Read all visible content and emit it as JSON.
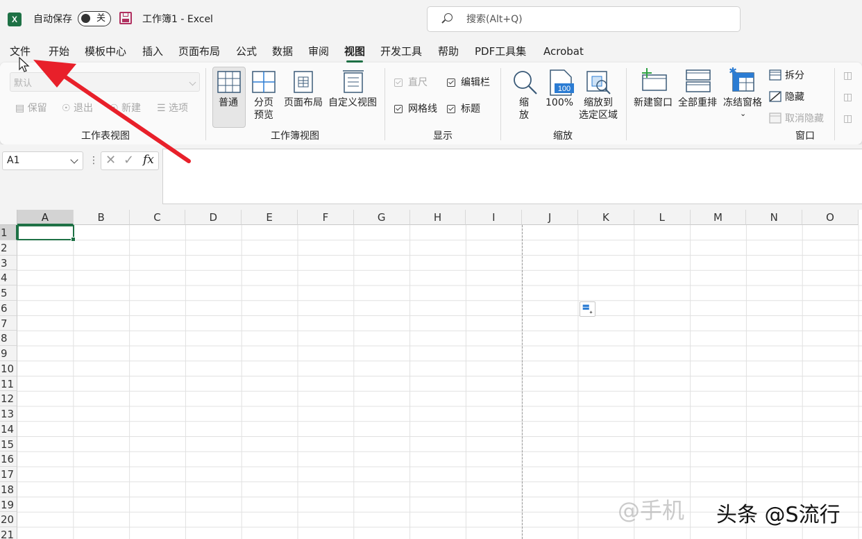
{
  "titlebar": {
    "app_logo": "X",
    "autosave_label": "自动保存",
    "autosave_state": "关",
    "doc_title": "工作簿1  -  Excel",
    "search_placeholder": "搜索(Alt+Q)"
  },
  "menu": {
    "tabs": [
      "文件",
      "开始",
      "模板中心",
      "插入",
      "页面布局",
      "公式",
      "数据",
      "审阅",
      "视图",
      "开发工具",
      "帮助",
      "PDF工具集",
      "Acrobat"
    ],
    "active": "视图"
  },
  "ribbon": {
    "sheet_view": {
      "combo_value": "默认",
      "keep": "保留",
      "exit": "退出",
      "new": "新建",
      "options": "选项",
      "label": "工作表视图"
    },
    "workbook_view": {
      "normal": "普通",
      "page_break_1": "分页",
      "page_break_2": "预览",
      "page_layout": "页面布局",
      "custom": "自定义视图",
      "label": "工作簿视图"
    },
    "show": {
      "ruler": "直尺",
      "formula_bar": "编辑栏",
      "gridlines": "网格线",
      "headings": "标题",
      "label": "显示"
    },
    "zoom": {
      "zoom_1": "缩",
      "zoom_2": "放",
      "hundred": "100%",
      "hundred_icon": "100",
      "to_sel_1": "缩放到",
      "to_sel_2": "选定区域",
      "label": "缩放"
    },
    "window": {
      "new_window": "新建窗口",
      "arrange_all": "全部重排",
      "freeze": "冻结窗格",
      "split": "拆分",
      "hide": "隐藏",
      "unhide": "取消隐藏",
      "label": "窗口"
    }
  },
  "formula_bar": {
    "name_box": "A1",
    "fx": "fx"
  },
  "grid": {
    "columns": [
      "A",
      "B",
      "C",
      "D",
      "E",
      "F",
      "G",
      "H",
      "I",
      "J",
      "K",
      "L",
      "M",
      "N",
      "O"
    ],
    "rows": [
      "1",
      "2",
      "3",
      "4",
      "5",
      "6",
      "7",
      "8",
      "9",
      "10",
      "11",
      "12",
      "13",
      "14",
      "15",
      "16",
      "17",
      "18",
      "19",
      "20",
      "21"
    ]
  },
  "watermark": {
    "faded": "@手机",
    "source": "头条 @S流行"
  },
  "colors": {
    "accent": "#1e7145",
    "annotation_arrow": "#e8202a"
  }
}
